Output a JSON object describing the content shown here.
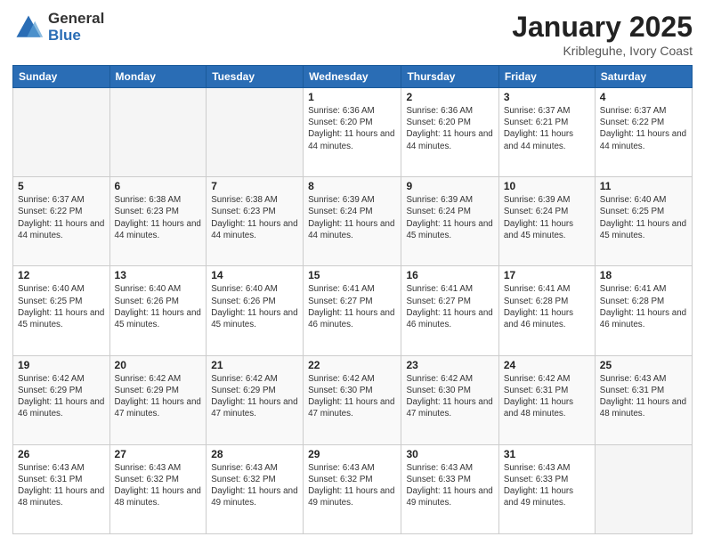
{
  "header": {
    "logo_general": "General",
    "logo_blue": "Blue",
    "month_title": "January 2025",
    "location": "Kribleguhe, Ivory Coast"
  },
  "weekdays": [
    "Sunday",
    "Monday",
    "Tuesday",
    "Wednesday",
    "Thursday",
    "Friday",
    "Saturday"
  ],
  "weeks": [
    [
      {
        "num": "",
        "info": ""
      },
      {
        "num": "",
        "info": ""
      },
      {
        "num": "",
        "info": ""
      },
      {
        "num": "1",
        "info": "Sunrise: 6:36 AM\nSunset: 6:20 PM\nDaylight: 11 hours and 44 minutes."
      },
      {
        "num": "2",
        "info": "Sunrise: 6:36 AM\nSunset: 6:20 PM\nDaylight: 11 hours and 44 minutes."
      },
      {
        "num": "3",
        "info": "Sunrise: 6:37 AM\nSunset: 6:21 PM\nDaylight: 11 hours and 44 minutes."
      },
      {
        "num": "4",
        "info": "Sunrise: 6:37 AM\nSunset: 6:22 PM\nDaylight: 11 hours and 44 minutes."
      }
    ],
    [
      {
        "num": "5",
        "info": "Sunrise: 6:37 AM\nSunset: 6:22 PM\nDaylight: 11 hours and 44 minutes."
      },
      {
        "num": "6",
        "info": "Sunrise: 6:38 AM\nSunset: 6:23 PM\nDaylight: 11 hours and 44 minutes."
      },
      {
        "num": "7",
        "info": "Sunrise: 6:38 AM\nSunset: 6:23 PM\nDaylight: 11 hours and 44 minutes."
      },
      {
        "num": "8",
        "info": "Sunrise: 6:39 AM\nSunset: 6:24 PM\nDaylight: 11 hours and 44 minutes."
      },
      {
        "num": "9",
        "info": "Sunrise: 6:39 AM\nSunset: 6:24 PM\nDaylight: 11 hours and 45 minutes."
      },
      {
        "num": "10",
        "info": "Sunrise: 6:39 AM\nSunset: 6:24 PM\nDaylight: 11 hours and 45 minutes."
      },
      {
        "num": "11",
        "info": "Sunrise: 6:40 AM\nSunset: 6:25 PM\nDaylight: 11 hours and 45 minutes."
      }
    ],
    [
      {
        "num": "12",
        "info": "Sunrise: 6:40 AM\nSunset: 6:25 PM\nDaylight: 11 hours and 45 minutes."
      },
      {
        "num": "13",
        "info": "Sunrise: 6:40 AM\nSunset: 6:26 PM\nDaylight: 11 hours and 45 minutes."
      },
      {
        "num": "14",
        "info": "Sunrise: 6:40 AM\nSunset: 6:26 PM\nDaylight: 11 hours and 45 minutes."
      },
      {
        "num": "15",
        "info": "Sunrise: 6:41 AM\nSunset: 6:27 PM\nDaylight: 11 hours and 46 minutes."
      },
      {
        "num": "16",
        "info": "Sunrise: 6:41 AM\nSunset: 6:27 PM\nDaylight: 11 hours and 46 minutes."
      },
      {
        "num": "17",
        "info": "Sunrise: 6:41 AM\nSunset: 6:28 PM\nDaylight: 11 hours and 46 minutes."
      },
      {
        "num": "18",
        "info": "Sunrise: 6:41 AM\nSunset: 6:28 PM\nDaylight: 11 hours and 46 minutes."
      }
    ],
    [
      {
        "num": "19",
        "info": "Sunrise: 6:42 AM\nSunset: 6:29 PM\nDaylight: 11 hours and 46 minutes."
      },
      {
        "num": "20",
        "info": "Sunrise: 6:42 AM\nSunset: 6:29 PM\nDaylight: 11 hours and 47 minutes."
      },
      {
        "num": "21",
        "info": "Sunrise: 6:42 AM\nSunset: 6:29 PM\nDaylight: 11 hours and 47 minutes."
      },
      {
        "num": "22",
        "info": "Sunrise: 6:42 AM\nSunset: 6:30 PM\nDaylight: 11 hours and 47 minutes."
      },
      {
        "num": "23",
        "info": "Sunrise: 6:42 AM\nSunset: 6:30 PM\nDaylight: 11 hours and 47 minutes."
      },
      {
        "num": "24",
        "info": "Sunrise: 6:42 AM\nSunset: 6:31 PM\nDaylight: 11 hours and 48 minutes."
      },
      {
        "num": "25",
        "info": "Sunrise: 6:43 AM\nSunset: 6:31 PM\nDaylight: 11 hours and 48 minutes."
      }
    ],
    [
      {
        "num": "26",
        "info": "Sunrise: 6:43 AM\nSunset: 6:31 PM\nDaylight: 11 hours and 48 minutes."
      },
      {
        "num": "27",
        "info": "Sunrise: 6:43 AM\nSunset: 6:32 PM\nDaylight: 11 hours and 48 minutes."
      },
      {
        "num": "28",
        "info": "Sunrise: 6:43 AM\nSunset: 6:32 PM\nDaylight: 11 hours and 49 minutes."
      },
      {
        "num": "29",
        "info": "Sunrise: 6:43 AM\nSunset: 6:32 PM\nDaylight: 11 hours and 49 minutes."
      },
      {
        "num": "30",
        "info": "Sunrise: 6:43 AM\nSunset: 6:33 PM\nDaylight: 11 hours and 49 minutes."
      },
      {
        "num": "31",
        "info": "Sunrise: 6:43 AM\nSunset: 6:33 PM\nDaylight: 11 hours and 49 minutes."
      },
      {
        "num": "",
        "info": ""
      }
    ]
  ]
}
